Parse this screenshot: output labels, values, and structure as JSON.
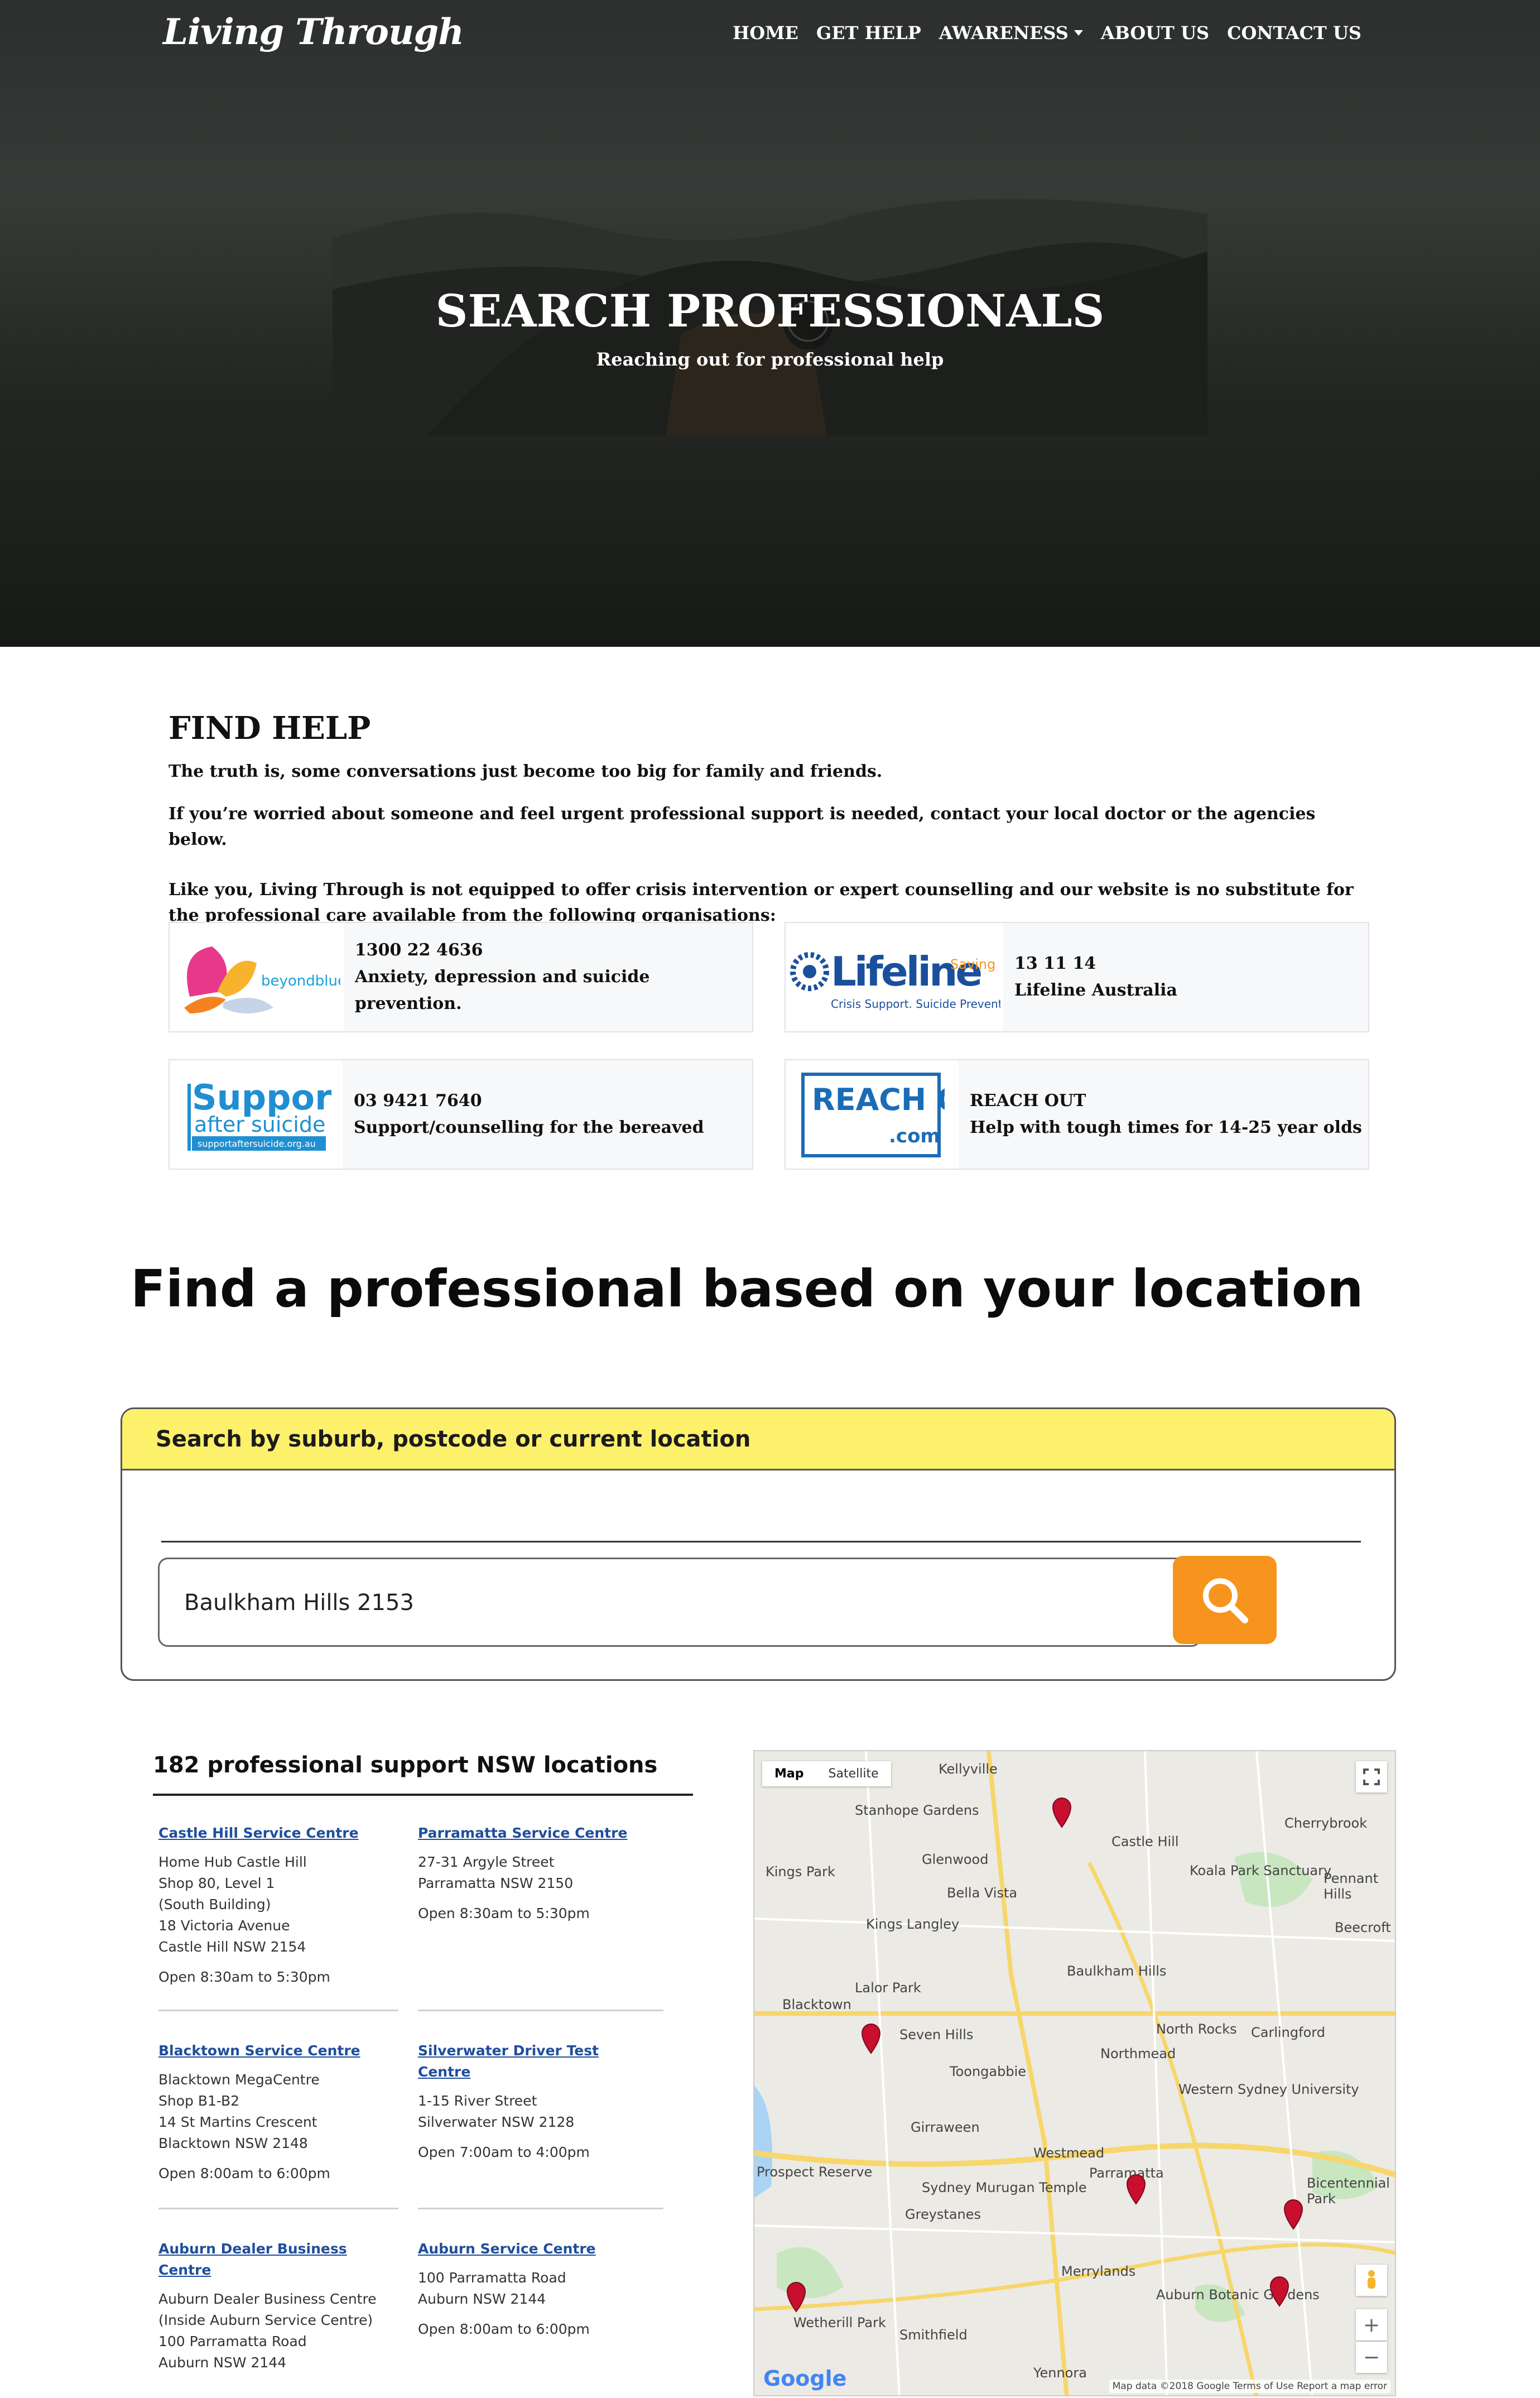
{
  "nav": {
    "logo": "Living Through",
    "items": [
      {
        "label": "HOME"
      },
      {
        "label": "GET HELP"
      },
      {
        "label": "AWARENESS"
      },
      {
        "label": "ABOUT US"
      },
      {
        "label": "CONTACT US"
      }
    ]
  },
  "hero": {
    "title": "SEARCH PROFESSIONALS",
    "subtitle": "Reaching out for professional help"
  },
  "find_help": {
    "heading": "FIND HELP",
    "p1": "The truth is, some conversations just become too big for family and friends.",
    "p2": "If you’re worried about someone and feel urgent professional support is needed, contact your local doctor or the agencies below.",
    "p3": "Like you, Living Through is not equipped to offer crisis intervention or expert counselling and our website is no substitute for the professional care available from the following organisations:"
  },
  "agencies": [
    {
      "logo_text": "beyondblue",
      "phone": "1300 22 4636",
      "desc": "Anxiety, depression and suicide prevention."
    },
    {
      "logo_text": "Lifeline",
      "logo_sub": "Crisis Support. Suicide Prevention.",
      "logo_tag": "Saving Lives",
      "phone": "13 11 14",
      "desc": "Lifeline Australia"
    },
    {
      "logo_text": "Support",
      "logo_sub": "after suicide",
      "logo_url": "supportaftersuicide.org.au",
      "phone": "03 9421 7640",
      "desc": "Support/counselling for the bereaved"
    },
    {
      "logo_text": "REACH OUT",
      "logo_sub": ".com",
      "phone": "REACH OUT",
      "desc": "Help with tough times for 14-25 year olds"
    }
  ],
  "location": {
    "title": "Find a professional based on your location",
    "search_heading": "Search by suburb, postcode or current location",
    "search_value": "Baulkham Hills 2153"
  },
  "results": {
    "heading": "182 professional support NSW locations",
    "items": [
      {
        "name": "Castle Hill Service Centre",
        "lines": [
          "Home Hub Castle Hill",
          "Shop 80, Level 1",
          "(South Building)",
          "18 Victoria Avenue",
          "Castle Hill NSW 2154"
        ],
        "hours": "Open 8:30am to 5:30pm"
      },
      {
        "name": "Parramatta Service Centre",
        "lines": [
          "27-31 Argyle Street",
          "Parramatta NSW 2150"
        ],
        "hours": "Open 8:30am to 5:30pm"
      },
      {
        "name": "Blacktown Service Centre",
        "lines": [
          "Blacktown MegaCentre",
          "Shop B1-B2",
          "14 St Martins Crescent",
          "Blacktown NSW 2148"
        ],
        "hours": "Open 8:00am to 6:00pm"
      },
      {
        "name": "Silverwater Driver Test Centre",
        "lines": [
          "1-15 River Street",
          "Silverwater NSW 2128"
        ],
        "hours": "Open 7:00am to 4:00pm"
      },
      {
        "name": "Auburn Dealer Business Centre",
        "lines": [
          "Auburn Dealer Business Centre",
          "(Inside Auburn Service Centre)",
          "100 Parramatta Road",
          "Auburn NSW 2144"
        ],
        "hours": ""
      },
      {
        "name": "Auburn Service Centre",
        "lines": [
          "100 Parramatta Road",
          "Auburn NSW 2144"
        ],
        "hours": "Open 8:00am to 6:00pm"
      }
    ]
  },
  "map": {
    "tab_map": "Map",
    "tab_satellite": "Satellite",
    "labels": [
      "Kellyville",
      "Stanhope Gardens",
      "Castle Hill",
      "Cherrybrook",
      "Kings Park",
      "Glenwood",
      "Koala Park Sanctuary",
      "Bella Vista",
      "Kings Langley",
      "Pennant Hills",
      "Beecroft",
      "Baulkham Hills",
      "Lalor Park",
      "Blacktown",
      "Seven Hills",
      "North Rocks",
      "Carlingford",
      "Northmead",
      "Toongabbie",
      "Western Sydney University",
      "Girraween",
      "Westmead",
      "Parramatta",
      "Sydney Murugan Temple",
      "Greystanes",
      "Bicentennial Park",
      "Merrylands",
      "Auburn Botanic Gardens",
      "Wetherill Park",
      "Smithfield",
      "Yennora",
      "Prospect Reserve"
    ],
    "google": "Google",
    "attribution": "Map data ©2018 Google   Terms of Use   Report a map error",
    "pin_color": "#c8102e"
  },
  "colors": {
    "search_head": "#fdf06b",
    "search_button": "#f7941d",
    "link": "#1f4e9c"
  }
}
